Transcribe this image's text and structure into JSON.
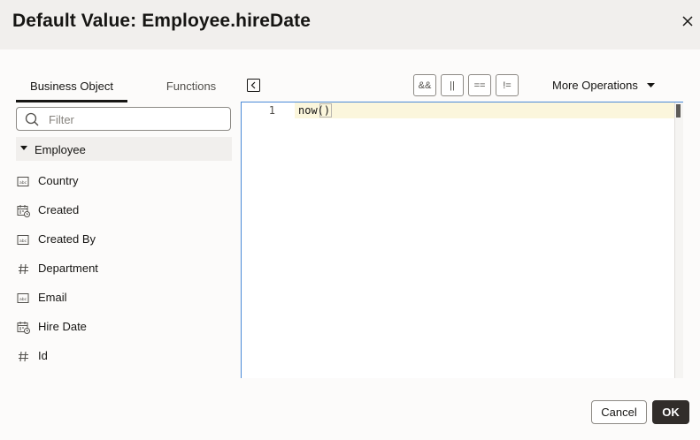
{
  "dialog": {
    "title": "Default Value: Employee.hireDate",
    "close_icon": "close-icon"
  },
  "tabs": [
    {
      "label": "Business Object",
      "selected": true
    },
    {
      "label": "Functions",
      "selected": false
    }
  ],
  "filter": {
    "placeholder": "Filter",
    "value": ""
  },
  "tree": {
    "root_label": "Employee",
    "fields": [
      {
        "label": "Country",
        "icon": "text-field-icon"
      },
      {
        "label": "Created",
        "icon": "datetime-field-icon"
      },
      {
        "label": "Created By",
        "icon": "text-field-icon"
      },
      {
        "label": "Department",
        "icon": "number-field-icon"
      },
      {
        "label": "Email",
        "icon": "text-field-icon"
      },
      {
        "label": "Hire Date",
        "icon": "datetime-field-icon"
      },
      {
        "label": "Id",
        "icon": "number-field-icon"
      }
    ]
  },
  "toolbar": {
    "and_label": "&&",
    "or_label": "||",
    "eq_label": "==",
    "neq_label": "!=",
    "more_operations_label": "More Operations"
  },
  "editor": {
    "line_number": "1",
    "code": "now()"
  },
  "footer": {
    "cancel_label": "Cancel",
    "ok_label": "OK"
  },
  "colors": {
    "header_bg": "#f1efed",
    "primary_button": "#312d2a",
    "editor_border": "#4a8ad8",
    "line_highlight": "#fbf6dc"
  }
}
